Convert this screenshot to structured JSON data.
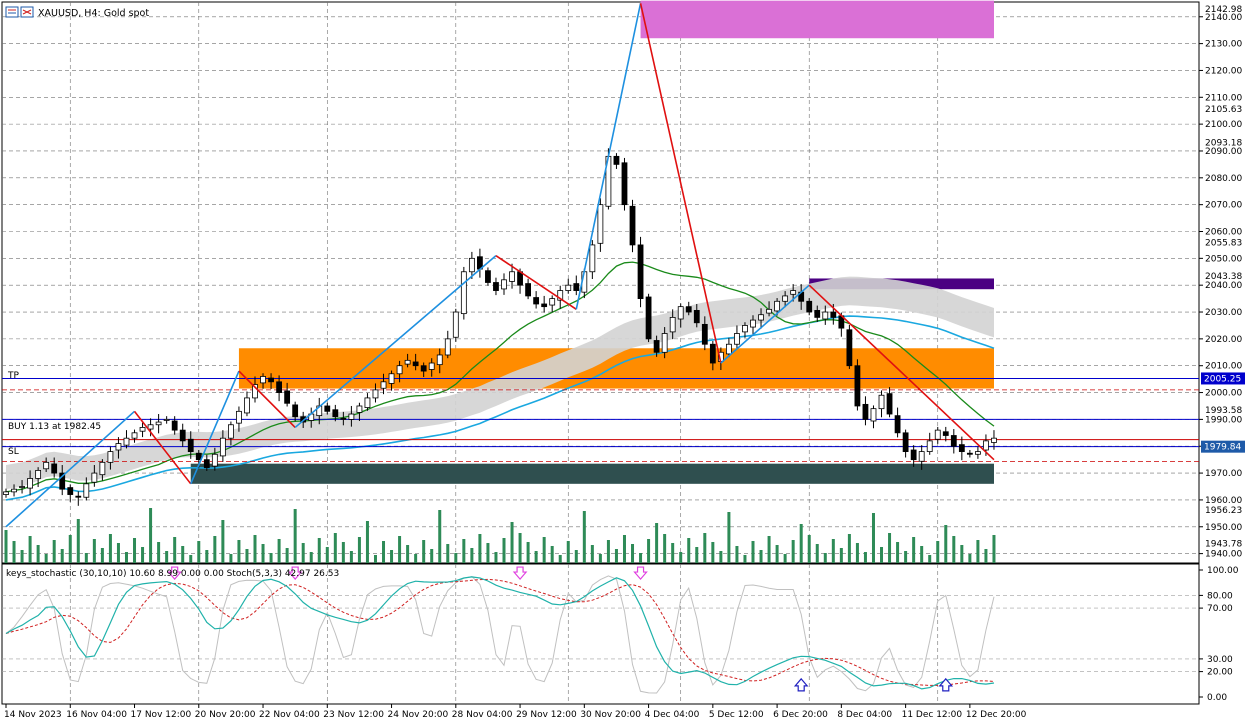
{
  "header": {
    "title": "XAUUSD, H4:  Gold spot",
    "symbol_icon": "chart-window-icon"
  },
  "overlays": {
    "tp_label": "TP",
    "sl_label": "SL",
    "buy_label": "BUY 1.13 at 1982.45"
  },
  "indicator": {
    "label": "keys_stochastic (30,10,10) 10.60 8.99 0.00 0.00 Stoch(5,3,3) 42.97 26.53"
  },
  "colors": {
    "bull": "#ffffff",
    "bear": "#000000",
    "zigzag_up": "#1e90e0",
    "zigzag_down": "#e01010",
    "ma_green": "#1a8a1a",
    "ma_blue": "#1aa8e0",
    "band": "#d3d3d3",
    "zone_orange": "#ff8c00",
    "zone_pink": "#da70d6",
    "zone_purple": "#4b0082",
    "zone_dark": "#2f4f4f",
    "volume": "#2e8b57",
    "tp_line": "#0000cc",
    "buy_line": "#cc0000",
    "current_tag": "#1e5aa8",
    "stoch_main": "#20b2aa",
    "stoch_signal": "#d02020",
    "stoch_fast": "#c0c0c0",
    "arrow_down": "#e040e0",
    "arrow_up": "#2020c0"
  },
  "chart_data": [
    {
      "type": "candlestick",
      "symbol": "XAUUSD",
      "timeframe": "H4",
      "y_ticks": [
        "2140.00",
        "2130.00",
        "2120.00",
        "2110.00",
        "2100.00",
        "2090.00",
        "2080.00",
        "2070.00",
        "2060.00",
        "2050.00",
        "2040.00",
        "2030.00",
        "2020.00",
        "2010.00",
        "2000.00",
        "1990.00",
        "1980.00",
        "1970.00",
        "1960.00",
        "1950.00",
        "1940.00"
      ],
      "y_tick_values": [
        2140,
        2130,
        2120,
        2110,
        2100,
        2090,
        2080,
        2070,
        2060,
        2050,
        2040,
        2030,
        2020,
        2010,
        2000,
        1990,
        1980,
        1970,
        1960,
        1950,
        1940
      ],
      "y_extra_labels": [
        "2142.98",
        "2105.63",
        "2093.18",
        "2055.83",
        "2043.38",
        "1993.58",
        "1956.23",
        "1943.78"
      ],
      "y_extra_values": [
        2142.98,
        2105.63,
        2093.18,
        2055.83,
        2043.38,
        1993.58,
        1956.23,
        1943.78
      ],
      "ylim": [
        1936.5,
        2145.5
      ],
      "x_ticks": [
        "14 Nov 2023",
        "16 Nov 04:00",
        "17 Nov 12:00",
        "20 Nov 20:00",
        "22 Nov 04:00",
        "23 Nov 12:00",
        "24 Nov 20:00",
        "28 Nov 04:00",
        "29 Nov 12:00",
        "30 Nov 20:00",
        "4 Dec 04:00",
        "5 Dec 12:00",
        "6 Dec 20:00",
        "8 Dec 04:00",
        "11 Dec 12:00",
        "12 Dec 20:00"
      ],
      "x_tick_bars": [
        0,
        8,
        16,
        24,
        32,
        40,
        48,
        56,
        64,
        72,
        80,
        88,
        96,
        104,
        112,
        120
      ],
      "bar_count": 124,
      "closes": [
        1963,
        1964,
        1965,
        1968,
        1971,
        1974,
        1970,
        1964,
        1962,
        1961,
        1966,
        1970,
        1974,
        1978,
        1981,
        1983,
        1985,
        1987,
        1988,
        1989,
        1990,
        1986,
        1982,
        1978,
        1975,
        1972,
        1977,
        1983,
        1988,
        1993,
        1998,
        2003,
        2006,
        2004,
        2000,
        1996,
        1991,
        1989,
        1992,
        1995,
        1993,
        1991,
        1990,
        1992,
        1995,
        1998,
        2001,
        2004,
        2007,
        2010,
        2012,
        2010,
        2008,
        2011,
        2014,
        2020,
        2030,
        2045,
        2050,
        2046,
        2041,
        2038,
        2042,
        2045,
        2040,
        2036,
        2033,
        2032,
        2035,
        2038,
        2040,
        2038,
        2045,
        2055,
        2070,
        2088,
        2085,
        2070,
        2055,
        2035,
        2020,
        2015,
        2022,
        2028,
        2032,
        2030,
        2026,
        2018,
        2011,
        2015,
        2018,
        2022,
        2025,
        2027,
        2029,
        2031,
        2034,
        2036,
        2038,
        2034,
        2030,
        2028,
        2030,
        2028,
        2024,
        2010,
        1995,
        1990,
        1994,
        1999,
        1992,
        1985,
        1978,
        1975,
        1978,
        1982,
        1986,
        1984,
        1980,
        1978,
        1977,
        1978,
        1982,
        1983
      ],
      "legend_values": {
        "tp": 2005.25,
        "buy_entry": 1982.45,
        "current": 1979.84,
        "sl": 1974.3
      },
      "zigzag_points": [
        {
          "bar": 0,
          "price": 1950
        },
        {
          "bar": 16,
          "price": 1993
        },
        {
          "bar": 23,
          "price": 1966
        },
        {
          "bar": 29,
          "price": 2008
        },
        {
          "bar": 36,
          "price": 1987
        },
        {
          "bar": 61,
          "price": 2051
        },
        {
          "bar": 71,
          "price": 2031
        },
        {
          "bar": 79,
          "price": 2145
        },
        {
          "bar": 89,
          "price": 2011
        },
        {
          "bar": 100,
          "price": 2040
        },
        {
          "bar": 123,
          "price": 1975
        }
      ],
      "zones": [
        {
          "label": "pink",
          "bar_from": 79,
          "bar_to": 124,
          "top": 2146,
          "bottom": 2132
        },
        {
          "label": "purple",
          "bar_from": 100,
          "bar_to": 124,
          "top": 2042.5,
          "bottom": 2038.5
        },
        {
          "label": "orange",
          "bar_from": 29,
          "bar_to": 124,
          "top": 2016.5,
          "bottom": 2001.5
        },
        {
          "label": "dark",
          "bar_from": 23,
          "bar_to": 124,
          "top": 1973.5,
          "bottom": 1966
        }
      ]
    },
    {
      "type": "line",
      "name": "keys_stochastic",
      "y_ticks": [
        "100.00",
        "80.00",
        "70.00",
        "30.00",
        "20.00",
        "0.00"
      ],
      "y_tick_values": [
        100,
        80,
        70,
        30,
        20,
        0
      ],
      "ylim": [
        0,
        100
      ],
      "arrows_down_bars": [
        21,
        36,
        64,
        79
      ],
      "arrows_up_bars": [
        99,
        117
      ]
    }
  ]
}
